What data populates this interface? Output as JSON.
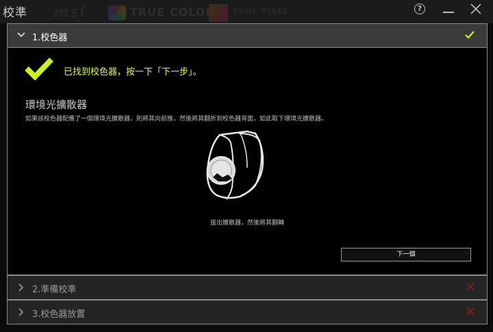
{
  "window": {
    "title": "校準",
    "brands": {
      "msi": "msi",
      "true_color": "TRUE COLOR",
      "true_pixel": "TRUE PIXEL"
    },
    "help_label": "?"
  },
  "steps": [
    {
      "label": "1.校色器",
      "status": "completed",
      "expanded": true
    },
    {
      "label": "2.準備校準",
      "status": "error",
      "expanded": false
    },
    {
      "label": "3.校色器放置",
      "status": "error",
      "expanded": false
    }
  ],
  "step1": {
    "found_message": "已找到校色器，按一下「下一步」。",
    "section_title": "環境光擴散器",
    "section_description": "如果該校色器配備了一個環境光擴散器，則將其向前推，然後將其翻折到校色器背面，如此取下環境光擴散器。",
    "caption": "拔出擴散器，然後將其翻轉",
    "next_button": "下一個"
  },
  "colors": {
    "accent": "#c8f31c",
    "error": "#7a1d1d",
    "header": "#3b3b3b"
  }
}
